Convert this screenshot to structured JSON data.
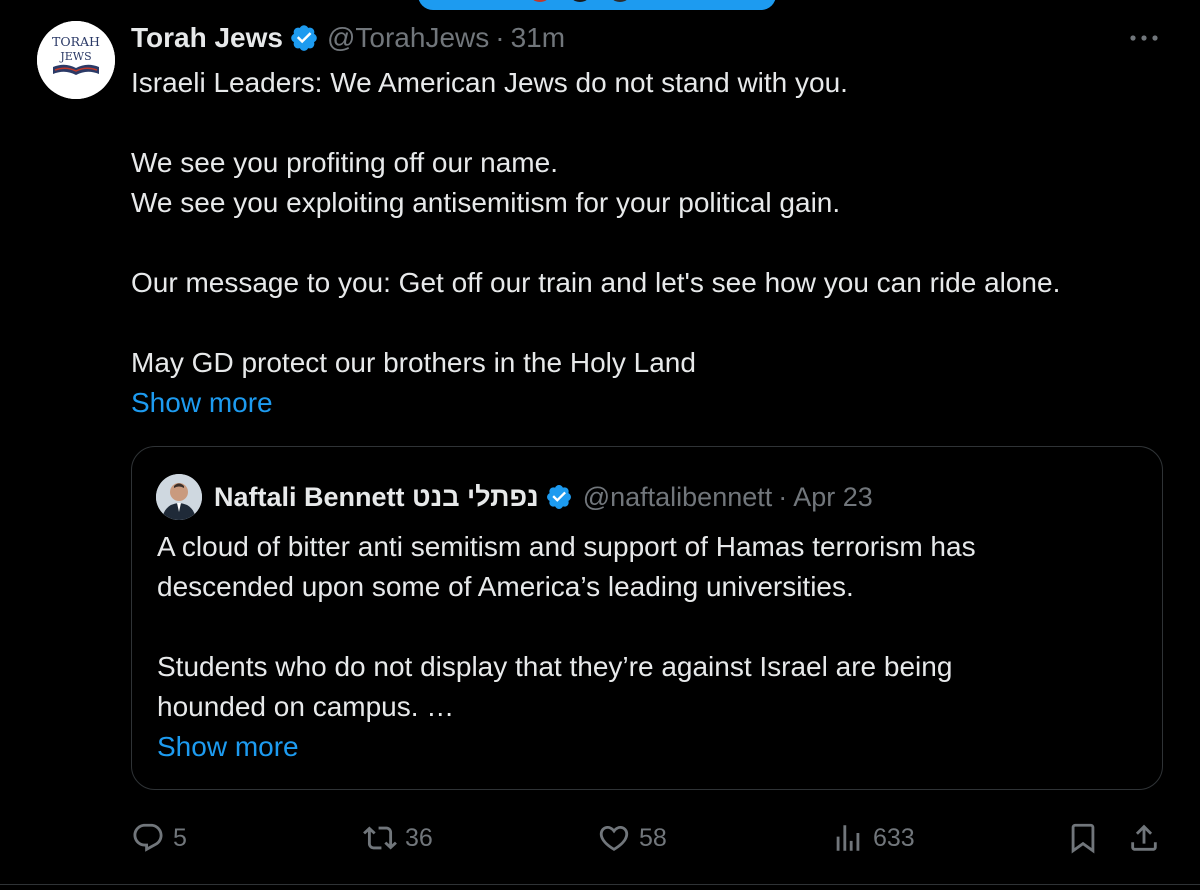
{
  "colors": {
    "background": "#000000",
    "text": "#e7e9ea",
    "muted": "#71767b",
    "accent": "#1d9bf0",
    "border": "#2f3336"
  },
  "tweet": {
    "avatar_logo_text": [
      "TORAH",
      "JEWS"
    ],
    "display_name": "Torah Jews",
    "handle": "@TorahJews",
    "separator": "·",
    "time": "31m",
    "icons": [
      "verified-badge-icon",
      "more-options-icon"
    ],
    "text_lines": [
      "Israeli Leaders: We American Jews do not stand with you.",
      "",
      "We see you profiting off our name.",
      "We see you exploiting antisemitism for your political gain.",
      "",
      "Our message to you: Get off our train and let's see how you can ride alone.",
      "",
      "May GD protect our brothers in the Holy Land"
    ],
    "show_more": "Show more"
  },
  "quote": {
    "display_name": "Naftali Bennett נפתלי בנט",
    "handle": "@naftalibennett",
    "separator": "·",
    "date": "Apr 23",
    "text_lines": [
      "A cloud of bitter anti semitism and support of Hamas terrorism has",
      "descended upon some of America’s leading universities.",
      "",
      "Students who do not display that they’re against Israel are being",
      "hounded on campus. …"
    ],
    "show_more": "Show more"
  },
  "actions": {
    "replies": "5",
    "reposts": "36",
    "likes": "58",
    "views": "633",
    "icons": [
      "reply-icon",
      "repost-icon",
      "like-icon",
      "views-icon",
      "bookmark-icon",
      "share-icon"
    ]
  }
}
